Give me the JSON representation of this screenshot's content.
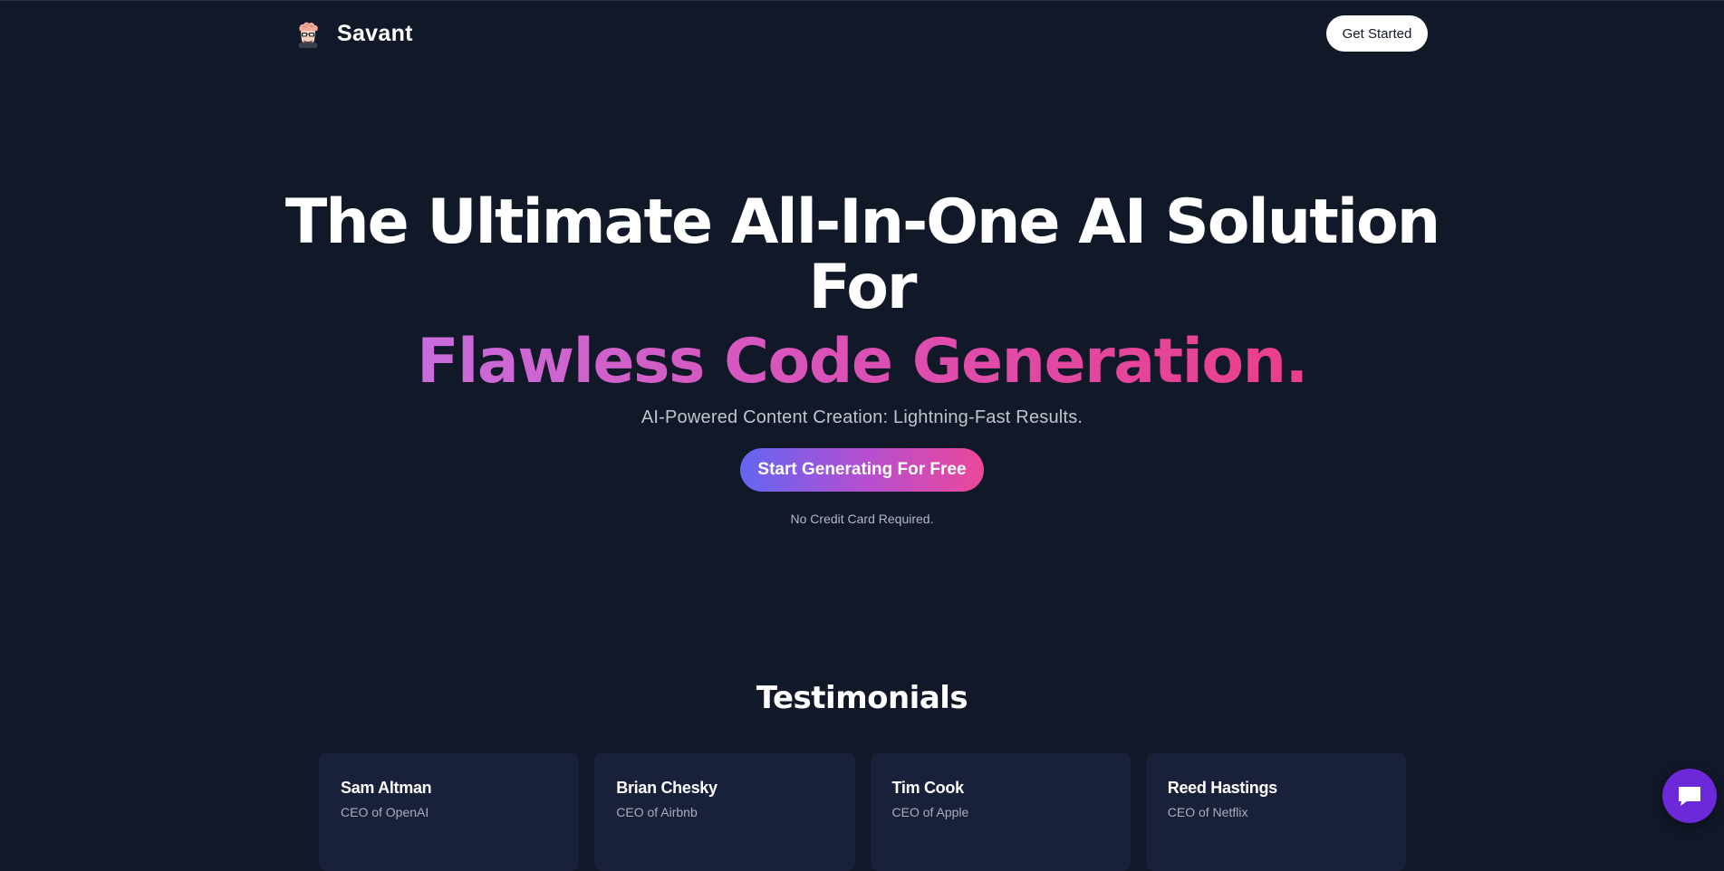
{
  "brand": {
    "name": "Savant",
    "logo_icon": "nerd-brain-avatar-icon"
  },
  "nav": {
    "get_started_label": "Get Started"
  },
  "hero": {
    "headline": "The Ultimate All-In-One AI Solution For",
    "gradient_headline": "Flawless Code Generation.",
    "subtitle": "AI-Powered Content Creation: Lightning-Fast Results.",
    "cta_label": "Start Generating For Free",
    "cta_note": "No Credit Card Required."
  },
  "testimonials": {
    "title": "Testimonials",
    "items": [
      {
        "name": "Sam Altman",
        "role": "CEO of OpenAI"
      },
      {
        "name": "Brian Chesky",
        "role": "CEO of Airbnb"
      },
      {
        "name": "Tim Cook",
        "role": "CEO of Apple"
      },
      {
        "name": "Reed Hastings",
        "role": "CEO of Netflix"
      }
    ]
  },
  "chat_widget": {
    "icon": "chat-bubble-icon"
  },
  "colors": {
    "background": "#111827",
    "card": "#192039",
    "gradient_start": "#c86ddc",
    "gradient_end": "#ec3e8a",
    "cta_start": "#6366f1",
    "cta_end": "#ec4899",
    "chat_widget": "#6d28d9"
  }
}
